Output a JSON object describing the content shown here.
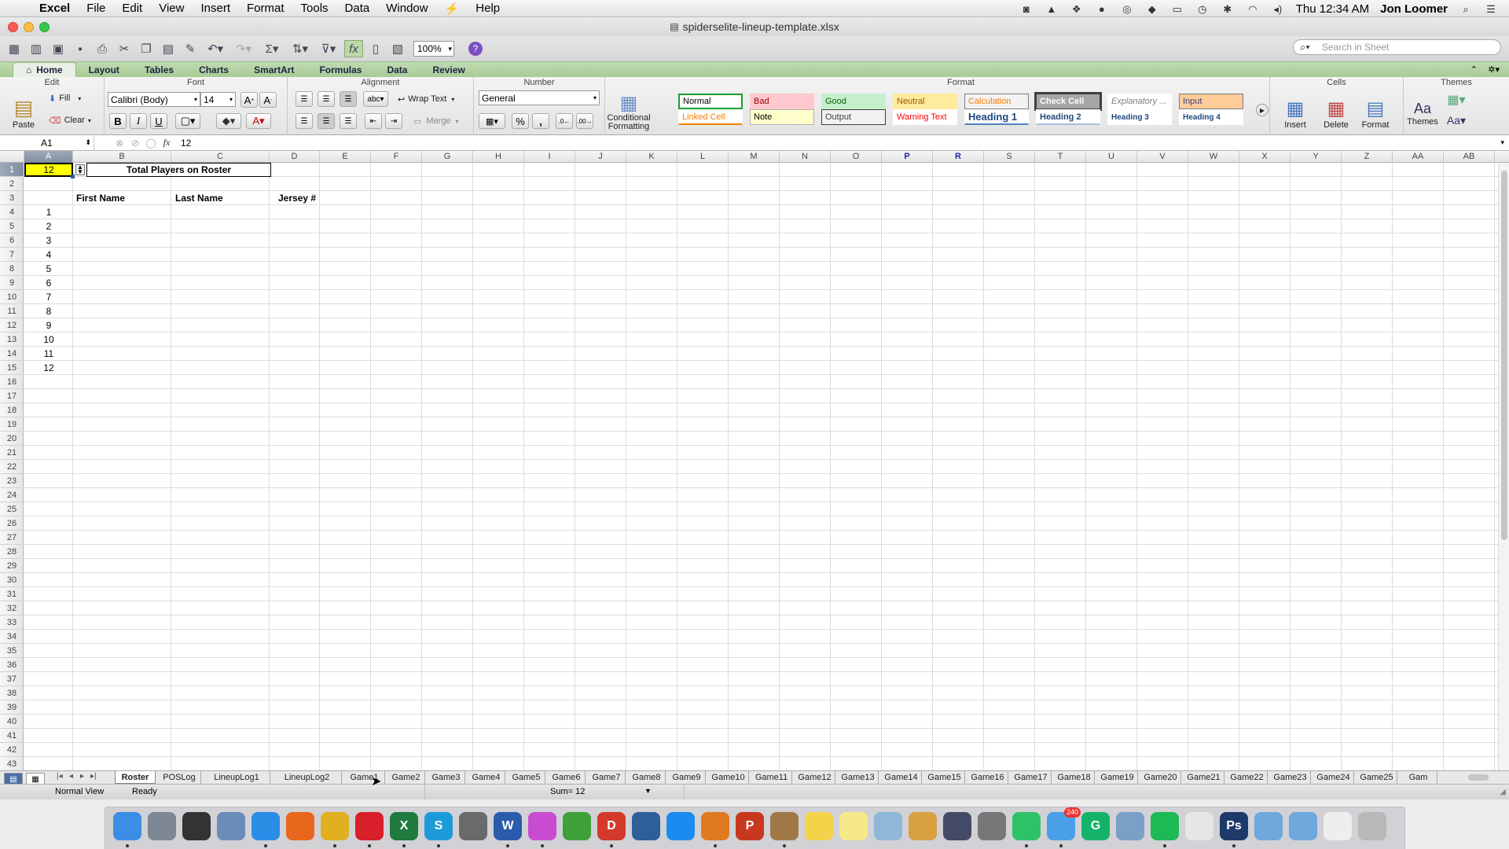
{
  "menubar": {
    "app": "Excel",
    "items": [
      "File",
      "Edit",
      "View",
      "Insert",
      "Format",
      "Tools",
      "Data",
      "Window",
      "⚡",
      "Help"
    ],
    "clock": "Thu 12:34 AM",
    "user": "Jon Loomer"
  },
  "window": {
    "title": "spiderselite-lineup-template.xlsx"
  },
  "toolbar": {
    "zoom": "100%",
    "search_placeholder": "Search in Sheet"
  },
  "ribbon": {
    "tabs": [
      "Home",
      "Layout",
      "Tables",
      "Charts",
      "SmartArt",
      "Formulas",
      "Data",
      "Review"
    ],
    "active_tab": "Home",
    "groups": {
      "edit": "Edit",
      "font": "Font",
      "alignment": "Alignment",
      "number": "Number",
      "format": "Format",
      "cells": "Cells",
      "themes": "Themes"
    },
    "paste": "Paste",
    "fill": "Fill",
    "clear": "Clear",
    "font_name": "Calibri (Body)",
    "font_size": "14",
    "bold": "B",
    "italic": "I",
    "underline": "U",
    "wrap_text": "Wrap Text",
    "merge": "Merge",
    "abc": "abc",
    "number_format": "General",
    "percent": "%",
    "comma": ",",
    "conditional_formatting": [
      "Conditional",
      "Formatting"
    ],
    "styles": [
      {
        "label": "Normal",
        "bg": "#ffffff",
        "fg": "#000000",
        "border": "#1a9e2a"
      },
      {
        "label": "Bad",
        "bg": "#ffc7ce",
        "fg": "#9c0006",
        "border": "#ffc7ce"
      },
      {
        "label": "Good",
        "bg": "#c6efce",
        "fg": "#006100",
        "border": "#c6efce"
      },
      {
        "label": "Neutral",
        "bg": "#ffeb9c",
        "fg": "#9c5700",
        "border": "#ffeb9c"
      },
      {
        "label": "Calculation",
        "bg": "#f2f2f2",
        "fg": "#fa7d00",
        "border": "#7f7f7f"
      },
      {
        "label": "Check Cell",
        "bg": "#a5a5a5",
        "fg": "#ffffff",
        "border": "#3f3f3f"
      },
      {
        "label": "Explanatory ...",
        "bg": "#ffffff",
        "fg": "#7f7f7f",
        "border": "#ffffff"
      },
      {
        "label": "Input",
        "bg": "#ffcc99",
        "fg": "#3f3f76",
        "border": "#7f7f7f"
      },
      {
        "label": "Linked Cell",
        "bg": "#ffffff",
        "fg": "#fa7d00",
        "border": "#ffffff"
      },
      {
        "label": "Note",
        "bg": "#ffffcc",
        "fg": "#000000",
        "border": "#b2b2b2"
      },
      {
        "label": "Output",
        "bg": "#f2f2f2",
        "fg": "#3f3f3f",
        "border": "#3f3f3f"
      },
      {
        "label": "Warning Text",
        "bg": "#ffffff",
        "fg": "#ff0000",
        "border": "#ffffff"
      },
      {
        "label": "Heading 1",
        "bg": "#ffffff",
        "fg": "#1f497d",
        "border": "#ffffff"
      },
      {
        "label": "Heading 2",
        "bg": "#ffffff",
        "fg": "#1f497d",
        "border": "#ffffff"
      },
      {
        "label": "Heading 3",
        "bg": "#ffffff",
        "fg": "#1f497d",
        "border": "#ffffff"
      },
      {
        "label": "Heading 4",
        "bg": "#ffffff",
        "fg": "#1f497d",
        "border": "#ffffff"
      }
    ],
    "cells_buttons": [
      "Insert",
      "Delete",
      "Format"
    ],
    "themes_buttons": [
      "Themes",
      "Aa"
    ]
  },
  "formula_bar": {
    "cell_ref": "A1",
    "value": "12",
    "fx": "fx"
  },
  "columns": [
    "A",
    "B",
    "C",
    "D",
    "E",
    "F",
    "G",
    "H",
    "I",
    "J",
    "K",
    "L",
    "M",
    "N",
    "O",
    "P",
    "R",
    "S",
    "T",
    "U",
    "V",
    "W",
    "X",
    "Y",
    "Z",
    "AA",
    "AB"
  ],
  "rows": [
    "1",
    "2",
    "3",
    "4",
    "5",
    "6",
    "7",
    "8",
    "9",
    "10",
    "11",
    "12",
    "13",
    "14",
    "15",
    "16",
    "17",
    "18",
    "19",
    "20",
    "21",
    "22",
    "23",
    "24",
    "25",
    "26",
    "27",
    "28",
    "29",
    "30",
    "31",
    "32",
    "33",
    "34",
    "35",
    "36",
    "37",
    "38",
    "39",
    "40",
    "41",
    "42",
    "43"
  ],
  "sheet": {
    "a1_value": "12",
    "title": "Total Players on Roster",
    "headers": {
      "first": "First Name",
      "last": "Last Name",
      "jersey": "Jersey #"
    },
    "numbers": [
      "1",
      "2",
      "3",
      "4",
      "5",
      "6",
      "7",
      "8",
      "9",
      "10",
      "11",
      "12"
    ]
  },
  "sheet_tabs": [
    "Roster",
    "POSLog",
    "LineupLog1",
    "LineupLog2",
    "Game1",
    "Game2",
    "Game3",
    "Game4",
    "Game5",
    "Game6",
    "Game7",
    "Game8",
    "Game9",
    "Game10",
    "Game11",
    "Game12",
    "Game13",
    "Game14",
    "Game15",
    "Game16",
    "Game17",
    "Game18",
    "Game19",
    "Game20",
    "Game21",
    "Game22",
    "Game23",
    "Game24",
    "Game25",
    "Gam"
  ],
  "status": {
    "view": "Normal View",
    "state": "Ready",
    "sum": "Sum= 12"
  },
  "dock": [
    "Finder",
    "Launchpad",
    "Dashboard",
    "Preview",
    "Safari",
    "Firefox",
    "Chrome",
    "Opera",
    "Excel",
    "Skype",
    "Cisco",
    "Word",
    "iTunes",
    "Evernote",
    "Todoist",
    "iPhoto",
    "App Store",
    "iBooks",
    "Parallels",
    "Contacts",
    "Notes",
    "Stickies",
    "Maps",
    "Photos",
    "Movie",
    "System Preferences",
    "FaceTime",
    "Mail",
    "Grammarly",
    "Xcode",
    "Spotify",
    "TextEdit",
    "Photoshop",
    "Folder",
    "Applications",
    "Document",
    "Trash"
  ],
  "dock_labels": {
    "excel": "X",
    "skype": "S",
    "word": "W",
    "photoshop": "Ps",
    "todoist": "D",
    "parallels": "P",
    "grammarly": "G",
    "mail_badge": "240"
  }
}
